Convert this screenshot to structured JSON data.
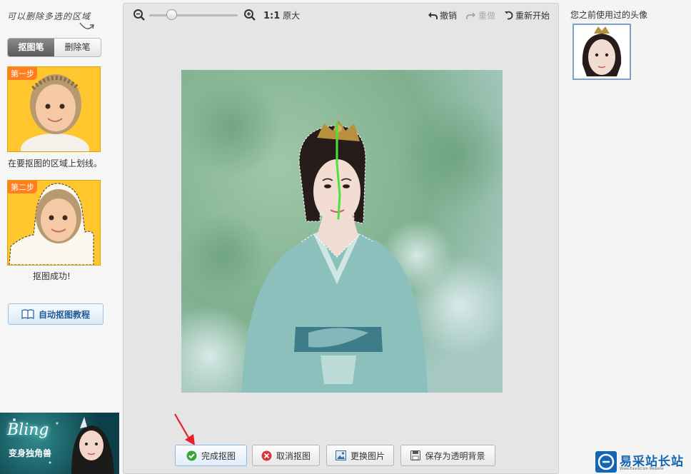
{
  "left": {
    "hint": "可以删除多选的区域",
    "tabs": [
      {
        "label": "抠图笔",
        "active": true
      },
      {
        "label": "删除笔",
        "active": false
      }
    ],
    "steps": [
      {
        "tag": "第一步",
        "caption": "在要抠图的区域上划线。"
      },
      {
        "tag": "第二步",
        "caption": "抠图成功!"
      }
    ],
    "tutorial_button": "自动抠图教程",
    "banner": {
      "title": "Bling",
      "subtitle": "变身独角兽"
    }
  },
  "toolbar": {
    "zoom_value": 0.22,
    "ratio_bold": "1:1",
    "ratio_label": "原大",
    "undo": "撤销",
    "redo": "重做",
    "restart": "重新开始"
  },
  "bottom_buttons": {
    "finish": "完成抠图",
    "cancel": "取消抠图",
    "change": "更换图片",
    "save": "保存为透明背景"
  },
  "right": {
    "recent_title": "您之前使用过的头像"
  },
  "brand": {
    "name": "易采站长站",
    "sub": "Www.EasckCom Website"
  },
  "colors": {
    "accent_blue": "#1466b4",
    "stroke_green": "#4be33a",
    "arrow_red": "#e5202c",
    "step_bg": "#ffb800"
  }
}
